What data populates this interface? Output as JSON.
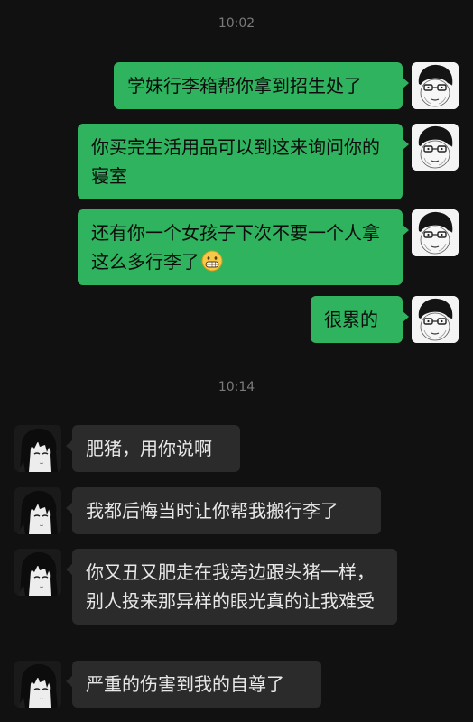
{
  "timestamps": [
    "10:02",
    "10:14"
  ],
  "messages": [
    {
      "side": "right",
      "text": "学妹行李箱帮你拿到招生处了"
    },
    {
      "side": "right",
      "text": "你买完生活用品可以到这来询问你的寝室"
    },
    {
      "side": "right",
      "text": "还有你一个女孩子下次不要一个人拿这么多行李了",
      "emoji": "grimacing-face-emoji"
    },
    {
      "side": "right",
      "text": "很累的"
    },
    {
      "side": "left",
      "text": "肥猪，用你说啊"
    },
    {
      "side": "left",
      "text": "我都后悔当时让你帮我搬行李了"
    },
    {
      "side": "left",
      "text": "你又丑又肥走在我旁边跟头猪一样，别人投来那异样的眼光真的让我难受"
    },
    {
      "side": "left",
      "text": "严重的伤害到我的自尊了"
    }
  ],
  "colors": {
    "background": "#111111",
    "sent_bubble": "#2fb35e",
    "received_bubble": "#2b2b2b",
    "timestamp": "#7a7a7a"
  }
}
